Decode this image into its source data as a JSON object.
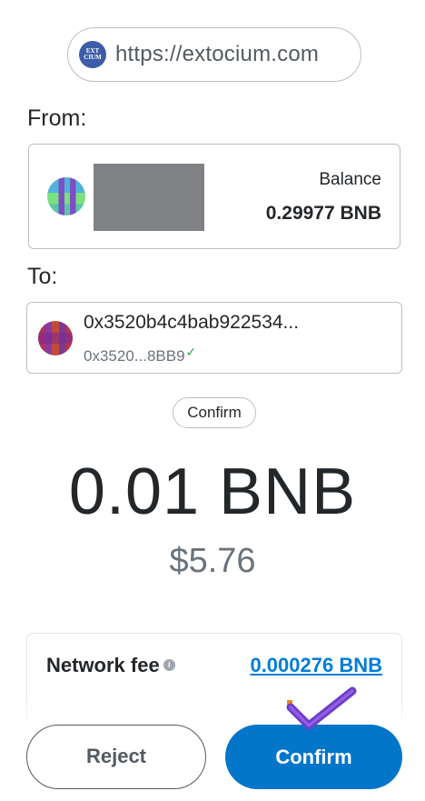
{
  "origin": {
    "url": "https://extocium.com",
    "logo_text": [
      "EXT",
      "CIUM"
    ]
  },
  "from": {
    "label": "From:",
    "account_badge": "b",
    "balance_label": "Balance",
    "balance_value": "0.29977 BNB"
  },
  "to": {
    "label": "To:",
    "address": "0x3520b4c4bab922534...",
    "short_address": "0x3520...8BB9"
  },
  "tag_button": "Confirm",
  "amount": "0.01 BNB",
  "fiat": "$5.76",
  "fee": {
    "label": "Network fee",
    "info_icon": "i",
    "value": "0.000276 BNB"
  },
  "actions": {
    "reject": "Reject",
    "confirm": "Confirm"
  },
  "colors": {
    "primary": "#0376c9",
    "link": "#037dd6",
    "check": "#7b3fd1"
  }
}
